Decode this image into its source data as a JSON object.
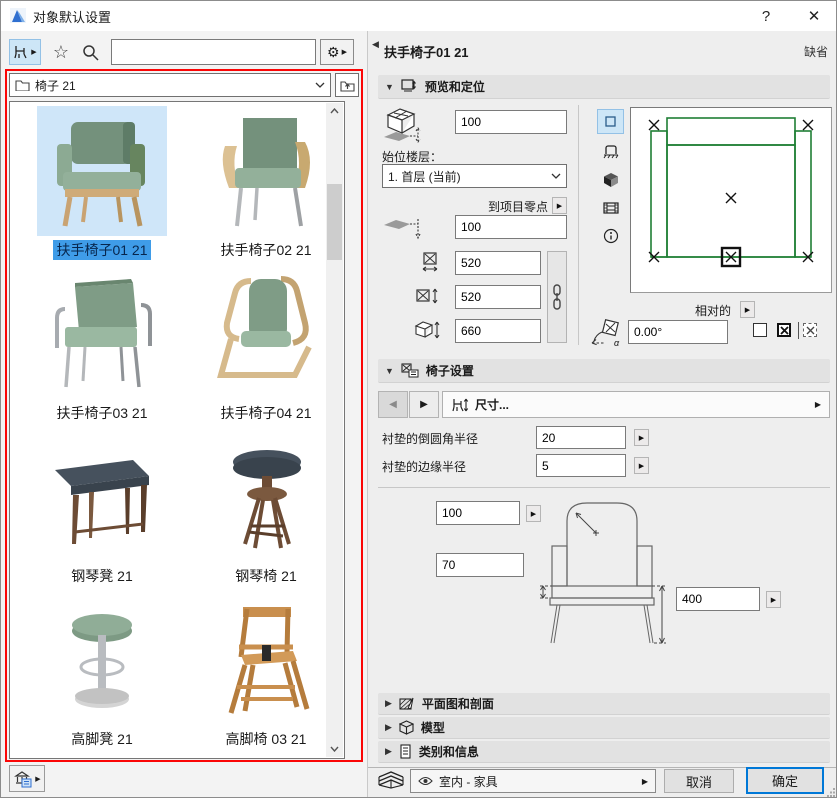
{
  "window": {
    "title": "对象默认设置",
    "help_label": "?",
    "close_label": "✕"
  },
  "toolbar": {
    "search_value": ""
  },
  "browser": {
    "folder_value": "椅子 21"
  },
  "items": [
    {
      "label": "扶手椅子01 21"
    },
    {
      "label": "扶手椅子02 21"
    },
    {
      "label": "扶手椅子03 21"
    },
    {
      "label": "扶手椅子04 21"
    },
    {
      "label": "钢琴凳 21"
    },
    {
      "label": "钢琴椅 21"
    },
    {
      "label": "高脚凳 21"
    },
    {
      "label": "高脚椅 03 21"
    }
  ],
  "panel": {
    "title": "扶手椅子01 21",
    "status": "缺省",
    "preview": {
      "section_title": "预览和定位",
      "top_offset": "100",
      "home_story_label": "始位楼层：",
      "home_story_value": "1. 首层 (当前)",
      "to_zero_label": "到项目零点",
      "bottom_offset": "100",
      "width": "520",
      "depth": "520",
      "height": "660",
      "relative_label": "相对的",
      "angle": "0.00°"
    },
    "chair": {
      "section_title": "椅子设置",
      "page_title": "尺寸...",
      "param1_label": "衬垫的倒圆角半径",
      "param1_value": "20",
      "param2_label": "衬垫的边缘半径",
      "param2_value": "5",
      "dim_radius": "100",
      "dim_seat": "70",
      "dim_height": "400"
    },
    "sections": {
      "floorplan": "平面图和剖面",
      "model": "模型",
      "classification": "类别和信息"
    },
    "footer": {
      "layer": "室内 - 家具",
      "cancel": "取消",
      "ok": "确定"
    }
  }
}
